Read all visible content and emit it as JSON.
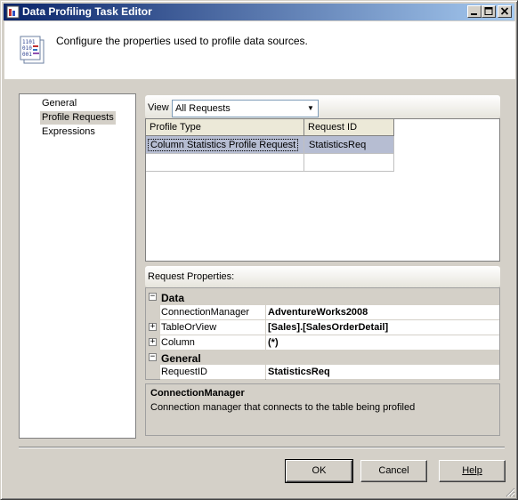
{
  "window": {
    "title": "Data Profiling Task Editor"
  },
  "header": {
    "description": "Configure the properties used to profile data sources."
  },
  "nav": {
    "items": [
      {
        "label": "General"
      },
      {
        "label": "Profile Requests",
        "selected": true
      },
      {
        "label": "Expressions"
      }
    ]
  },
  "view": {
    "label": "View",
    "selected": "All Requests"
  },
  "requests_grid": {
    "columns": [
      "Profile Type",
      "Request ID"
    ],
    "rows": [
      {
        "profile_type": "Column Statistics Profile Request",
        "request_id": "StatisticsReq"
      }
    ]
  },
  "request_properties": {
    "label": "Request Properties:",
    "categories": [
      {
        "name": "Data",
        "properties": [
          {
            "name": "ConnectionManager",
            "value": "AdventureWorks2008"
          },
          {
            "name": "TableOrView",
            "value": "[Sales].[SalesOrderDetail]"
          },
          {
            "name": "Column",
            "value": "(*)"
          }
        ]
      },
      {
        "name": "General",
        "properties": [
          {
            "name": "RequestID",
            "value": "StatisticsReq"
          }
        ]
      }
    ]
  },
  "description_panel": {
    "title": "ConnectionManager",
    "text": "Connection manager that connects to the table being profiled"
  },
  "buttons": {
    "ok": "OK",
    "cancel": "Cancel",
    "help": "Help"
  },
  "colors": {
    "title_bar_start": "#0a246a",
    "title_bar_end": "#a6caf0",
    "selection": "#b6bdd2",
    "dialog_face": "#d4d0c8"
  }
}
